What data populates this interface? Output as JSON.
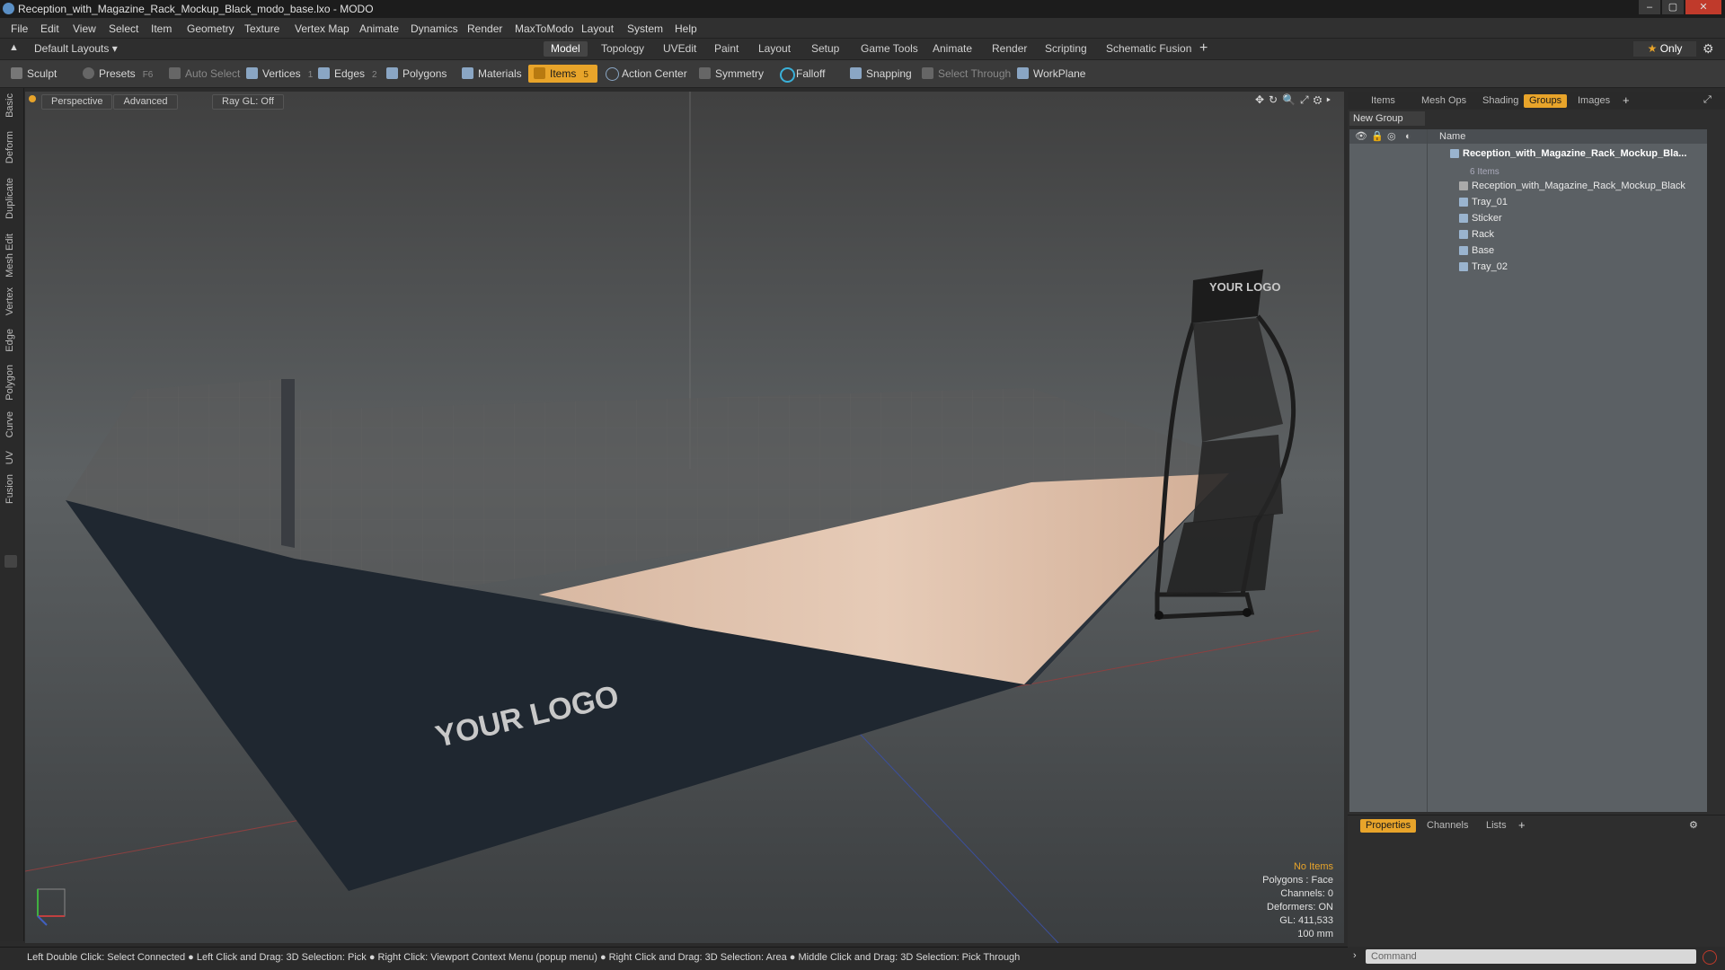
{
  "window": {
    "title": "Reception_with_Magazine_Rack_Mockup_Black_modo_base.lxo - MODO"
  },
  "menu": [
    "File",
    "Edit",
    "View",
    "Select",
    "Item",
    "Geometry",
    "Texture",
    "Vertex Map",
    "Animate",
    "Dynamics",
    "Render",
    "MaxToModo",
    "Layout",
    "System",
    "Help"
  ],
  "layoutbar": {
    "layout": "Default Layouts",
    "tabs": [
      "Model",
      "Topology",
      "UVEdit",
      "Paint",
      "Layout",
      "Setup",
      "Game Tools",
      "Animate",
      "Render",
      "Scripting",
      "Schematic Fusion"
    ],
    "active_tab": "Model",
    "only": "Only"
  },
  "toolbar": {
    "sculpt": "Sculpt",
    "presets": "Presets",
    "presets_key": "F6",
    "auto_select": "Auto Select",
    "vertices": "Vertices",
    "vertices_count": "1",
    "edges": "Edges",
    "edges_count": "2",
    "polygons": "Polygons",
    "materials": "Materials",
    "items": "Items",
    "items_count": "5",
    "action_center": "Action Center",
    "symmetry": "Symmetry",
    "falloff": "Falloff",
    "snapping": "Snapping",
    "select_through": "Select Through",
    "workplane": "WorkPlane"
  },
  "left_tabs": [
    "Basic",
    "Deform",
    "Duplicate",
    "Mesh Edit",
    "Vertex",
    "Edge",
    "Polygon",
    "Curve",
    "UV",
    "Fusion"
  ],
  "viewport": {
    "view": "Perspective",
    "mode": "Advanced",
    "raygl": "Ray GL: Off",
    "logo_front": "YOUR LOGO",
    "logo_sign": "YOUR LOGO",
    "info": {
      "items": "No Items",
      "polygons": "Polygons : Face",
      "channels": "Channels: 0",
      "deformers": "Deformers: ON",
      "gl": "GL: 411,533",
      "scale": "100 mm"
    }
  },
  "status": "Left Double Click: Select Connected ● Left Click and Drag: 3D Selection: Pick ● Right Click: Viewport Context Menu (popup menu) ● Right Click and Drag: 3D Selection: Area ● Middle Click and Drag: 3D Selection: Pick Through",
  "right_panel": {
    "tabs": [
      "Items",
      "Mesh Ops",
      "Shading",
      "Groups",
      "Images"
    ],
    "active_tab": "Groups",
    "new_group": "New Group",
    "name_header": "Name",
    "group_name": "Reception_with_Magazine_Rack_Mockup_Bla...",
    "group_count": "6 Items",
    "items": [
      "Reception_with_Magazine_Rack_Mockup_Black",
      "Tray_01",
      "Sticker",
      "Rack",
      "Base",
      "Tray_02"
    ]
  },
  "bottom_panel": {
    "tabs": [
      "Properties",
      "Channels",
      "Lists"
    ],
    "active_tab": "Properties"
  },
  "command": {
    "placeholder": "Command"
  },
  "colors": {
    "accent": "#e8a42a",
    "panel": "#5b6064"
  }
}
